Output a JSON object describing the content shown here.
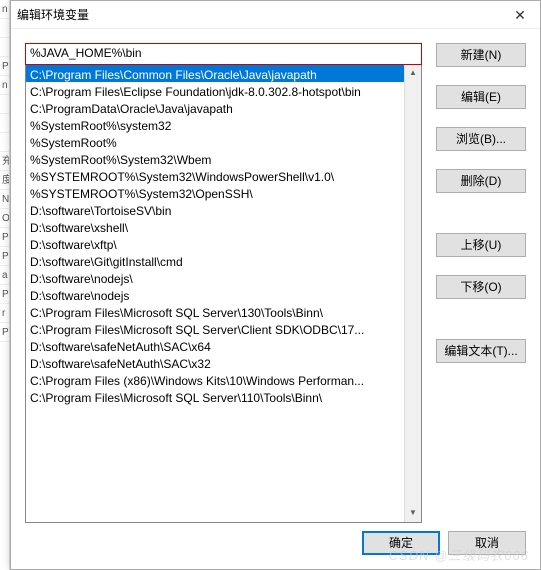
{
  "dialog": {
    "title": "编辑环境变量",
    "edit_value": "%JAVA_HOME%\\bin",
    "items": [
      "C:\\Program Files\\Common Files\\Oracle\\Java\\javapath",
      "C:\\Program Files\\Eclipse Foundation\\jdk-8.0.302.8-hotspot\\bin",
      "C:\\ProgramData\\Oracle\\Java\\javapath",
      "%SystemRoot%\\system32",
      "%SystemRoot%",
      "%SystemRoot%\\System32\\Wbem",
      "%SYSTEMROOT%\\System32\\WindowsPowerShell\\v1.0\\",
      "%SYSTEMROOT%\\System32\\OpenSSH\\",
      "D:\\software\\TortoiseSV\\bin",
      "D:\\software\\xshell\\",
      "D:\\software\\xftp\\",
      "D:\\software\\Git\\gitInstall\\cmd",
      "D:\\software\\nodejs\\",
      "D:\\software\\nodejs",
      "C:\\Program Files\\Microsoft SQL Server\\130\\Tools\\Binn\\",
      "C:\\Program Files\\Microsoft SQL Server\\Client SDK\\ODBC\\17...",
      "D:\\software\\safeNetAuth\\SAC\\x64",
      "D:\\software\\safeNetAuth\\SAC\\x32",
      "C:\\Program Files (x86)\\Windows Kits\\10\\Windows Performan...",
      "C:\\Program Files\\Microsoft SQL Server\\110\\Tools\\Binn\\"
    ],
    "selected_index": 0
  },
  "buttons": {
    "new_label": "新建(N)",
    "edit_label": "编辑(E)",
    "browse_label": "浏览(B)...",
    "delete_label": "删除(D)",
    "moveup_label": "上移(U)",
    "movedown_label": "下移(O)",
    "edittext_label": "编辑文本(T)...",
    "ok_label": "确定",
    "cancel_label": "取消"
  },
  "watermark": "CSDN @三级码农666",
  "strip_letters": [
    "n",
    "",
    "",
    "P",
    "n",
    "",
    "",
    "",
    "充",
    "度",
    "N",
    "O",
    "P",
    "P",
    "a",
    "P",
    "r",
    "P"
  ]
}
